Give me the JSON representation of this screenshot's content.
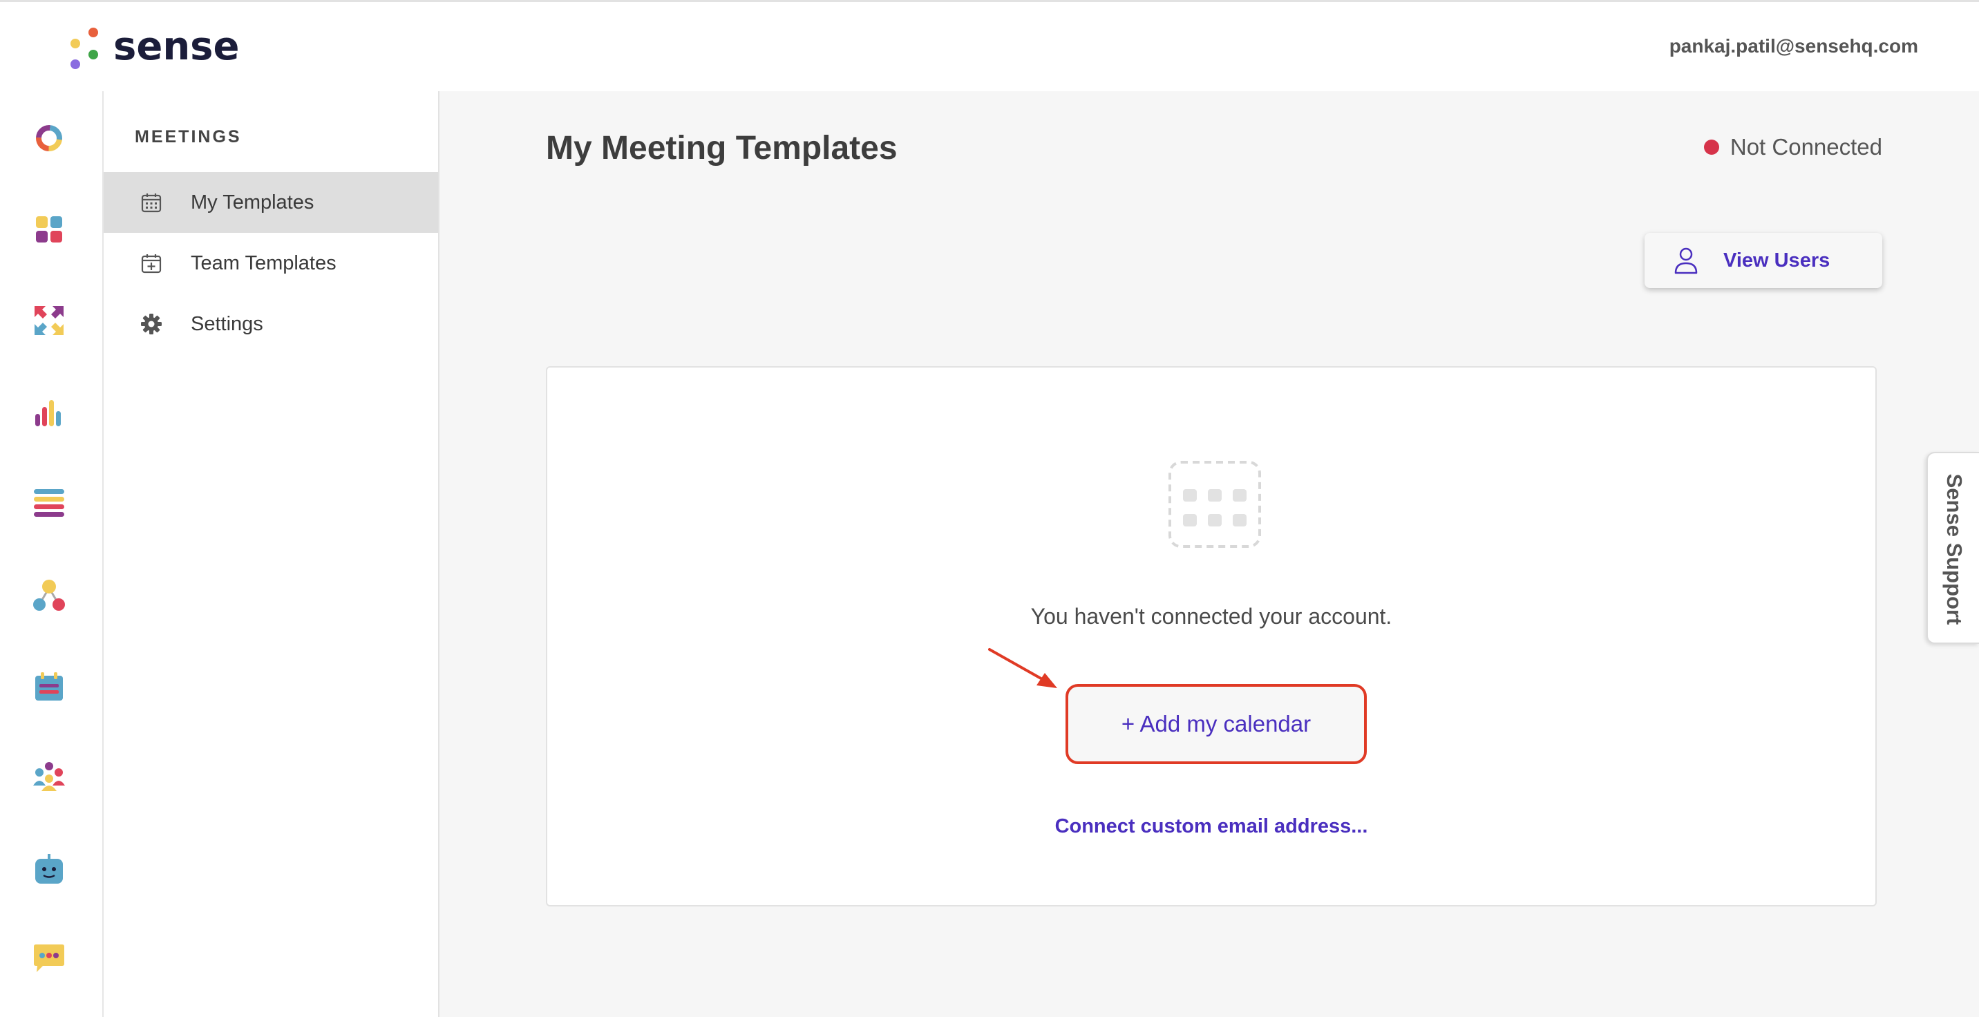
{
  "brand": {
    "name": "sense",
    "colors": {
      "wordmark": "#1b1d3a",
      "accent": "#4a2fbf",
      "highlight": "#e03a25"
    }
  },
  "header": {
    "user_email": "pankaj.patil@sensehq.com"
  },
  "rail": {
    "items": [
      {
        "icon": "donut-chart-icon"
      },
      {
        "icon": "apps-grid-icon"
      },
      {
        "icon": "arrows-exchange-icon"
      },
      {
        "icon": "bar-chart-icon"
      },
      {
        "icon": "list-icon"
      },
      {
        "icon": "workflow-icon"
      },
      {
        "icon": "calendar-icon"
      },
      {
        "icon": "people-icon"
      },
      {
        "icon": "bot-icon"
      },
      {
        "icon": "chat-icon"
      }
    ]
  },
  "subnav": {
    "heading": "MEETINGS",
    "items": [
      {
        "label": "My Templates",
        "icon": "calendar-grid-icon",
        "active": true
      },
      {
        "label": "Team Templates",
        "icon": "calendar-plus-icon",
        "active": false
      },
      {
        "label": "Settings",
        "icon": "gear-icon",
        "active": false
      }
    ]
  },
  "main": {
    "title": "My Meeting Templates",
    "status": {
      "label": "Not Connected",
      "color": "#d6334a"
    },
    "view_users_label": "View Users",
    "empty_state": {
      "message": "You haven't connected your account.",
      "add_calendar_label": "+ Add my calendar",
      "connect_link": "Connect custom email address..."
    }
  },
  "support": {
    "label": "Sense Support"
  }
}
